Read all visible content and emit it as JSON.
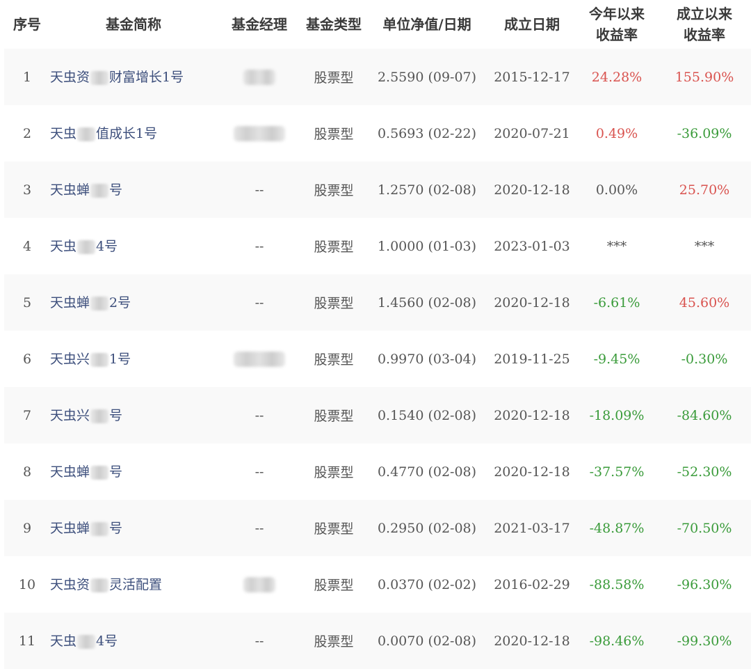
{
  "table": {
    "headers": {
      "index": "序号",
      "name": "基金简称",
      "manager": "基金经理",
      "type": "基金类型",
      "nav": "单位净值/日期",
      "inception": "成立日期",
      "ytd": "今年以来\n收益率",
      "since_inception": "成立以来\n收益率"
    },
    "rows": [
      {
        "index": "1",
        "name_a": "天虫资",
        "name_b": "财富增长1号",
        "manager": "",
        "manager_redacted": true,
        "type": "股票型",
        "nav": "2.5590 (09-07)",
        "inception": "2015-12-17",
        "ytd": "24.28%",
        "since": "155.90%"
      },
      {
        "index": "2",
        "name_a": "天虫",
        "name_b": "值成长1号",
        "manager": "",
        "manager_redacted": true,
        "type": "股票型",
        "nav": "0.5693 (02-22)",
        "inception": "2020-07-21",
        "ytd": "0.49%",
        "since": "-36.09%"
      },
      {
        "index": "3",
        "name_a": "天虫蝉",
        "name_b": "号",
        "manager": "--",
        "type": "股票型",
        "nav": "1.2570 (02-08)",
        "inception": "2020-12-18",
        "ytd": "0.00%",
        "since": "25.70%"
      },
      {
        "index": "4",
        "name_a": "天虫",
        "name_b": "4号",
        "manager": "--",
        "type": "股票型",
        "nav": "1.0000 (01-03)",
        "inception": "2023-01-03",
        "ytd": "***",
        "since": "***"
      },
      {
        "index": "5",
        "name_a": "天虫蝉",
        "name_b": "2号",
        "manager": "--",
        "type": "股票型",
        "nav": "1.4560 (02-08)",
        "inception": "2020-12-18",
        "ytd": "-6.61%",
        "since": "45.60%"
      },
      {
        "index": "6",
        "name_a": "天虫兴",
        "name_b": "1号",
        "manager": "",
        "manager_redacted": true,
        "type": "股票型",
        "nav": "0.9970 (03-04)",
        "inception": "2019-11-25",
        "ytd": "-9.45%",
        "since": "-0.30%"
      },
      {
        "index": "7",
        "name_a": "天虫兴",
        "name_b": "号",
        "manager": "--",
        "type": "股票型",
        "nav": "0.1540 (02-08)",
        "inception": "2020-12-18",
        "ytd": "-18.09%",
        "since": "-84.60%"
      },
      {
        "index": "8",
        "name_a": "天虫蝉",
        "name_b": "号",
        "manager": "--",
        "type": "股票型",
        "nav": "0.4770 (02-08)",
        "inception": "2020-12-18",
        "ytd": "-37.57%",
        "since": "-52.30%"
      },
      {
        "index": "9",
        "name_a": "天虫蝉",
        "name_b": "号",
        "manager": "--",
        "type": "股票型",
        "nav": "0.2950 (02-08)",
        "inception": "2021-03-17",
        "ytd": "-48.87%",
        "since": "-70.50%"
      },
      {
        "index": "10",
        "name_a": "天虫资",
        "name_b": "灵活配置",
        "manager": "",
        "manager_redacted": true,
        "type": "股票型",
        "nav": "0.0370 (02-02)",
        "inception": "2016-02-29",
        "ytd": "-88.58%",
        "since": "-96.30%"
      },
      {
        "index": "11",
        "name_a": "天虫",
        "name_b": "4号",
        "manager": "--",
        "type": "股票型",
        "nav": "0.0070 (02-08)",
        "inception": "2020-12-18",
        "ytd": "-98.46%",
        "since": "-99.30%"
      }
    ]
  },
  "colors": {
    "positive": "#d9534f",
    "negative": "#3a9b3a",
    "neutral": "#555555",
    "fund_name": "#3d4f7c",
    "stripe": "#f9f9f9"
  }
}
